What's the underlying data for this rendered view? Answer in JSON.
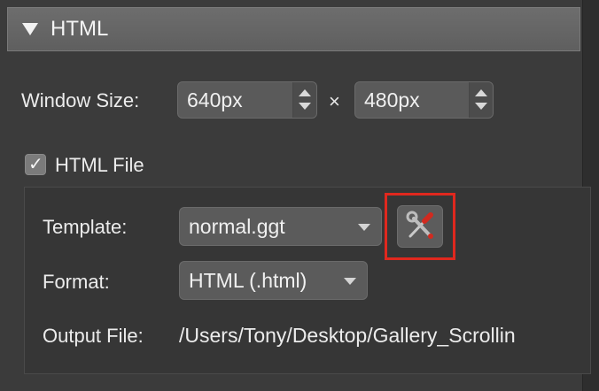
{
  "section": {
    "title": "HTML",
    "expanded": true
  },
  "window_size": {
    "label": "Window Size:",
    "width_value": "640px",
    "separator": "×",
    "height_value": "480px"
  },
  "html_file": {
    "checkbox_label": "HTML File",
    "checked": true,
    "check_glyph": "✓"
  },
  "template": {
    "label": "Template:",
    "selected": "normal.ggt",
    "tool_icon": "wrench-screwdriver-icon"
  },
  "format": {
    "label": "Format:",
    "selected": "HTML (.html)"
  },
  "output_file": {
    "label": "Output File:",
    "path": "/Users/Tony/Desktop/Gallery_Scrollin"
  },
  "colors": {
    "highlight": "#e0281e",
    "background": "#3b3b3b"
  }
}
